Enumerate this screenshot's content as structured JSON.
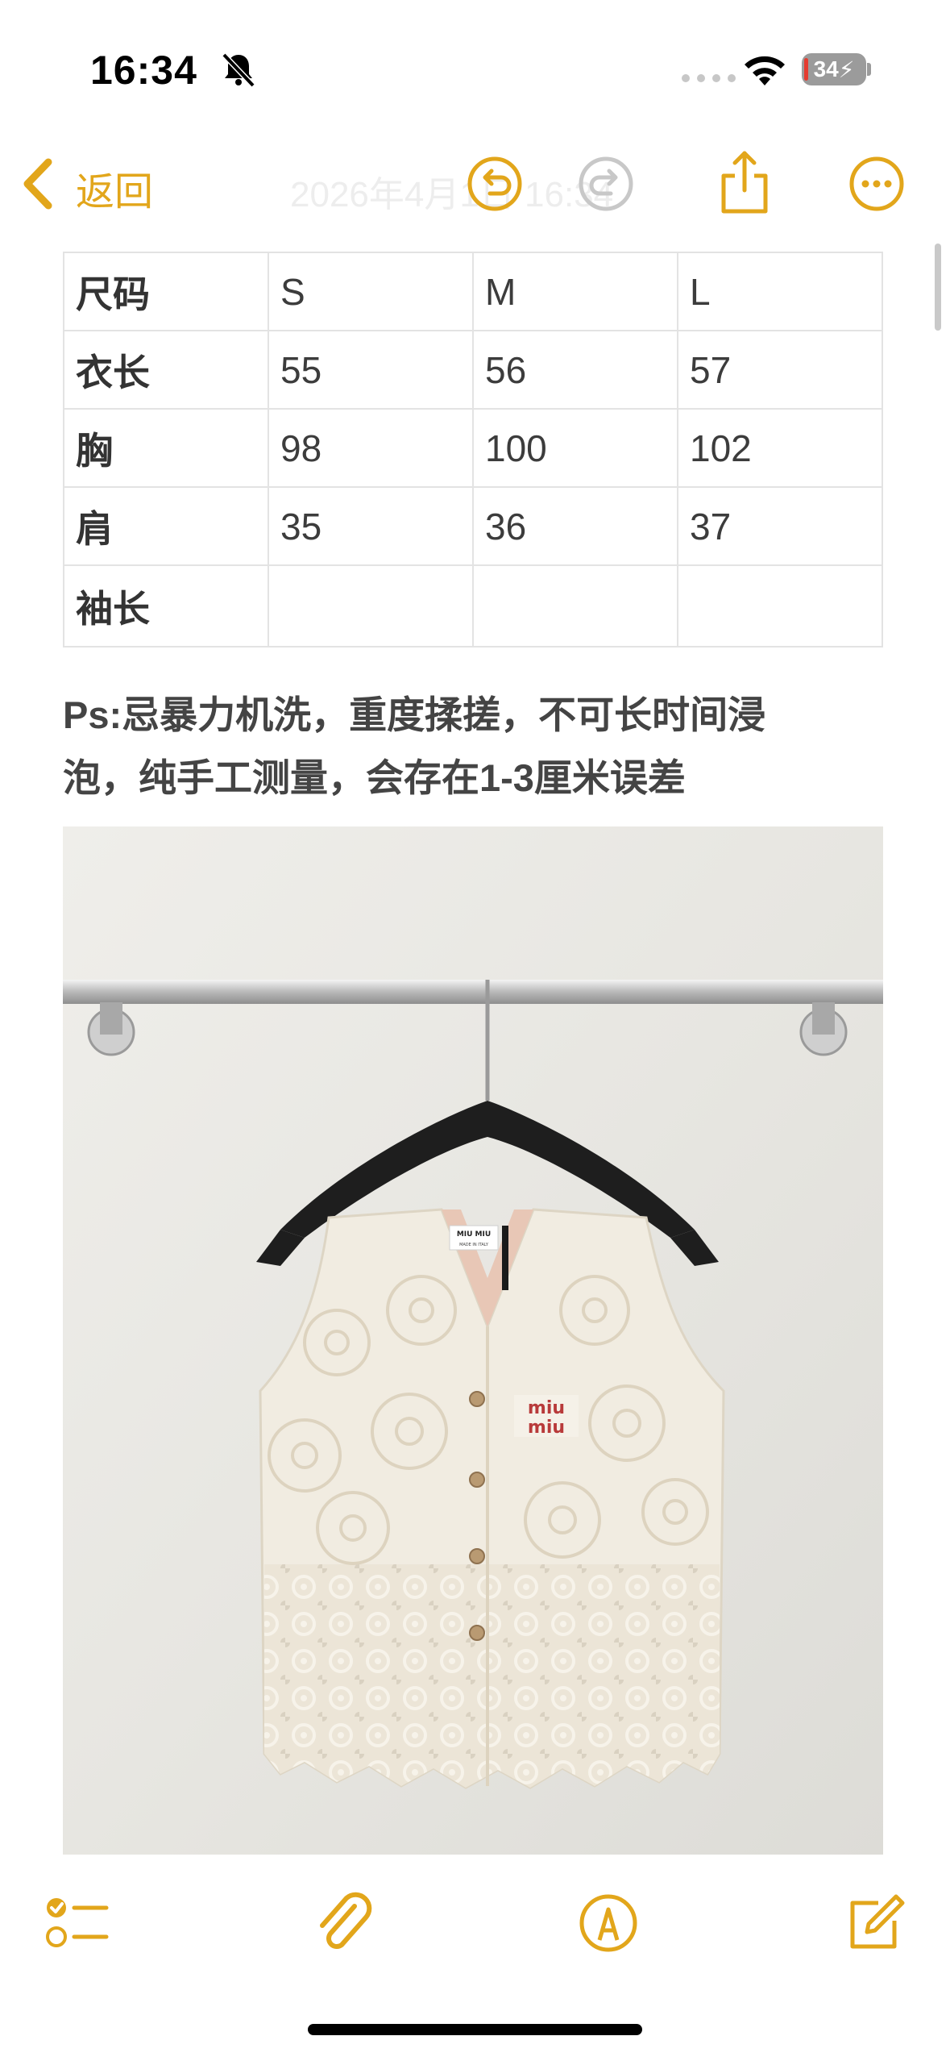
{
  "status_bar": {
    "time": "16:34",
    "battery": "34",
    "icons": [
      "bell-slash-icon",
      "cellular-signal-icon",
      "wifi-icon",
      "battery-icon"
    ]
  },
  "nav": {
    "back_label": "返回",
    "title": "2026年4月1日 16:34",
    "icons": [
      "chevron-left-icon",
      "undo-icon",
      "redo-icon",
      "share-icon",
      "more-icon"
    ]
  },
  "size_table": {
    "rows": [
      [
        "尺码",
        "S",
        "M",
        "L"
      ],
      [
        "衣长",
        "55",
        "56",
        "57"
      ],
      [
        "胸",
        "98",
        "100",
        "102"
      ],
      [
        "肩",
        "35",
        "36",
        "37"
      ],
      [
        "袖长",
        "",
        "",
        ""
      ]
    ]
  },
  "note": {
    "line1": "Ps:忌暴力机洗，重度揉搓，不可长时间浸",
    "line2": "泡，纯手工测量，会存在1-3厘米误差"
  },
  "photo": {
    "label_line1": "MIU MIU",
    "label_line2": "MADE IN ITALY",
    "logo_line1": "miu",
    "logo_line2": "miu"
  },
  "toolbar": {
    "icons": [
      "checklist-icon",
      "paperclip-icon",
      "markup-pen-icon",
      "compose-icon"
    ]
  },
  "colors": {
    "accent": "#e2a61b",
    "disabled": "#c8c8c8",
    "text": "#333333",
    "grid": "#e3e3e3"
  }
}
